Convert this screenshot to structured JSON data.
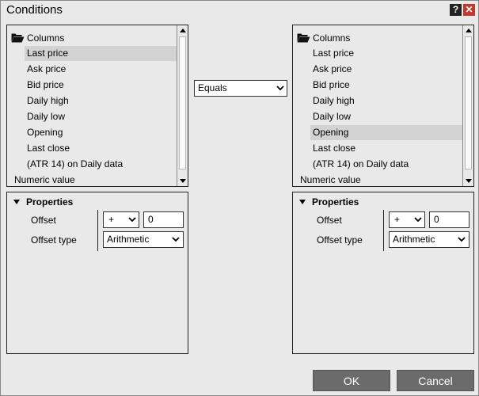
{
  "window": {
    "title": "Conditions",
    "help_label": "?",
    "close_label": "✕"
  },
  "left_list": {
    "folder_label": "Columns",
    "items": [
      "Last price",
      "Ask price",
      "Bid price",
      "Daily high",
      "Daily low",
      "Opening",
      "Last close",
      "(ATR 14) on Daily data"
    ],
    "selected": "Last price",
    "footer_label": "Numeric value"
  },
  "operator": {
    "value": "Equals"
  },
  "right_list": {
    "folder_label": "Columns",
    "items": [
      "Last price",
      "Ask price",
      "Bid price",
      "Daily high",
      "Daily low",
      "Opening",
      "Last close",
      "(ATR 14) on Daily data"
    ],
    "selected": "Opening",
    "footer_label": "Numeric value"
  },
  "left_props": {
    "header": "Properties",
    "offset_label": "Offset",
    "offset_type_label": "Offset type",
    "sign_value": "+",
    "offset_value": "0",
    "offset_type_value": "Arithmetic"
  },
  "right_props": {
    "header": "Properties",
    "offset_label": "Offset",
    "offset_type_label": "Offset type",
    "sign_value": "+",
    "offset_value": "0",
    "offset_type_value": "Arithmetic"
  },
  "buttons": {
    "ok_label": "OK",
    "cancel_label": "Cancel"
  }
}
